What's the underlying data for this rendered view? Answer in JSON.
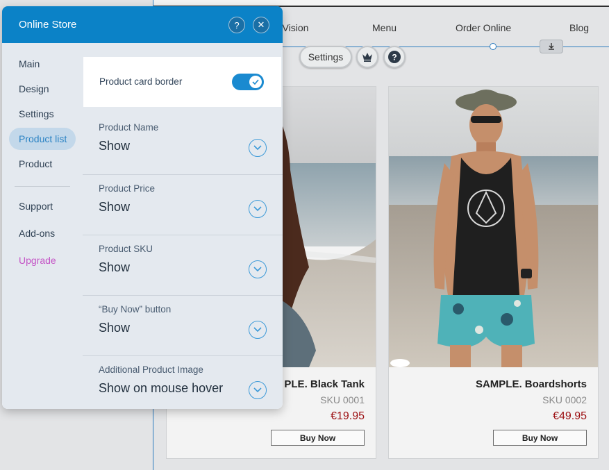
{
  "site": {
    "nav": [
      "r Vision",
      "Menu",
      "Order Online",
      "Blog"
    ],
    "toolbar": {
      "settings_label": "Settings"
    },
    "products": [
      {
        "name": "PLE. Black Tank",
        "sku": "SKU 0001",
        "price": "€19.95",
        "button": "Buy Now"
      },
      {
        "name": "SAMPLE. Boardshorts",
        "sku": "SKU 0002",
        "price": "€49.95",
        "button": "Buy Now"
      }
    ],
    "icons": {
      "download": "download-icon",
      "crown": "crown-icon",
      "help": "question-icon"
    }
  },
  "panel": {
    "title": "Online Store",
    "help_label": "?",
    "close_label": "✕",
    "sidebar": {
      "items": [
        "Main",
        "Design",
        "Settings",
        "Product list",
        "Product"
      ],
      "secondary": [
        "Support",
        "Add-ons"
      ],
      "upgrade": "Upgrade",
      "active_index": 3
    },
    "toggle": {
      "label": "Product card border",
      "on": true
    },
    "sections": [
      {
        "label": "Product Name",
        "value": "Show"
      },
      {
        "label": "Product Price",
        "value": "Show"
      },
      {
        "label": "Product SKU",
        "value": "Show"
      },
      {
        "label": "“Buy Now” button",
        "value": "Show"
      },
      {
        "label": "Additional Product Image",
        "value": "Show on mouse hover"
      }
    ]
  },
  "colors": {
    "header": "#0b82c7",
    "accent": "#1a8ad0",
    "upgrade": "#c454c6",
    "price": "#9c0f12"
  }
}
